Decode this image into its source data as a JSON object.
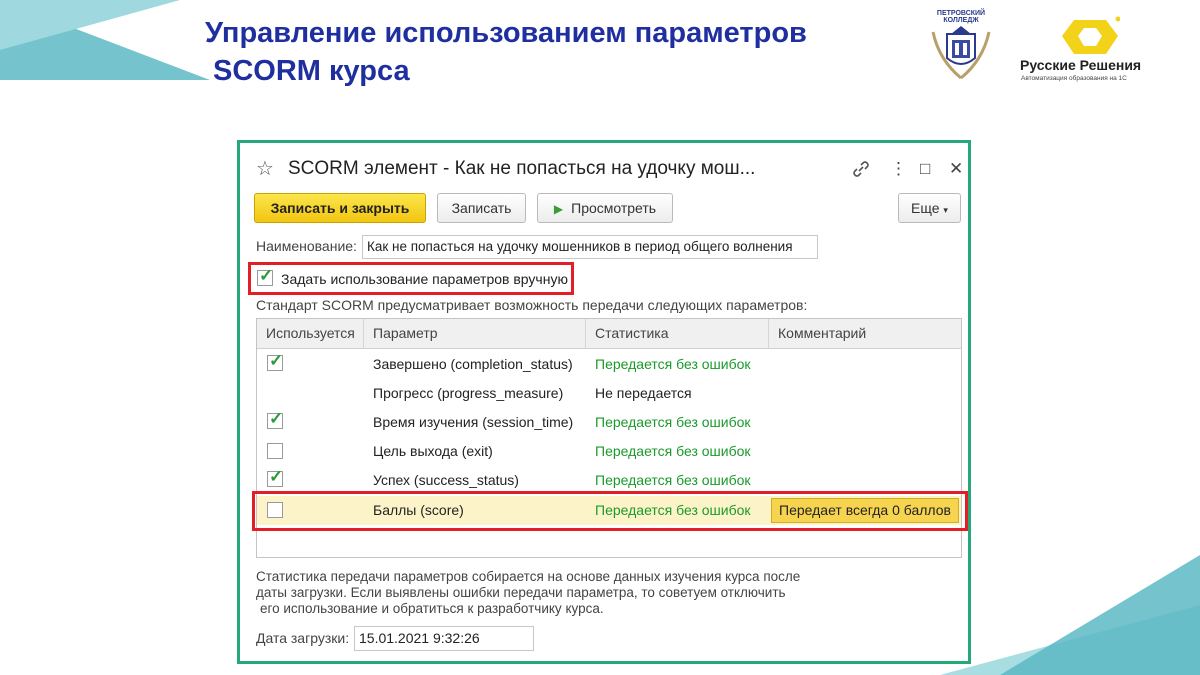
{
  "slide": {
    "title_line1": "Управление использованием параметров",
    "title_line2": "SCORM курса",
    "logo_left_text": "ПЕТРОВСКИЙ КОЛЛЕДЖ",
    "logo_right_name": "Русские Решения",
    "logo_right_sub": "Автоматизация образования на 1С",
    "accent_color": "#5cb8c4",
    "title_color": "#1f2fa0"
  },
  "window": {
    "title": "SCORM элемент - Как не попасться на удочку мош...",
    "icons": {
      "favorite": "star-icon",
      "link": "link-icon",
      "more": "more-vertical-icon",
      "maximize": "maximize-icon",
      "close": "close-icon"
    },
    "toolbar": {
      "save_close": "Записать и закрыть",
      "save": "Записать",
      "preview": "Просмотреть",
      "more": "Еще"
    },
    "name_label": "Наименование:",
    "name_value": "Как не попасться на удочку мошенников в период общего волнения",
    "manual_checkbox": {
      "label": "Задать использование параметров вручную",
      "checked": true
    },
    "standard_text": "Стандарт SCORM предусматривает возможность передачи следующих параметров:",
    "table": {
      "columns": [
        "Используется",
        "Параметр",
        "Статистика",
        "Комментарий"
      ],
      "rows": [
        {
          "used": true,
          "param": "Завершено (completion_status)",
          "stat": "Передается без ошибок",
          "comment": ""
        },
        {
          "used": null,
          "param": "Прогресс (progress_measure)",
          "stat": "Не передается",
          "comment": ""
        },
        {
          "used": true,
          "param": "Время изучения (session_time)",
          "stat": "Передается без ошибок",
          "comment": ""
        },
        {
          "used": false,
          "param": "Цель выхода (exit)",
          "stat": "Передается без ошибок",
          "comment": ""
        },
        {
          "used": true,
          "param": "Успех (success_status)",
          "stat": "Передается без ошибок",
          "comment": ""
        },
        {
          "used": false,
          "param": "Баллы (score)",
          "stat": "Передается без ошибок",
          "comment": "Передает всегда 0 баллов"
        }
      ]
    },
    "note_lines": [
      "Статистика передачи параметров собирается на основе данных изучения курса после",
      "даты загрузки. Если выявлены ошибки передачи параметра, то советуем отключить",
      "его использование и обратиться к разработчику курса."
    ],
    "date_label": "Дата загрузки:",
    "date_value": "15.01.2021  9:32:26",
    "highlight_color": "#e31e25"
  }
}
